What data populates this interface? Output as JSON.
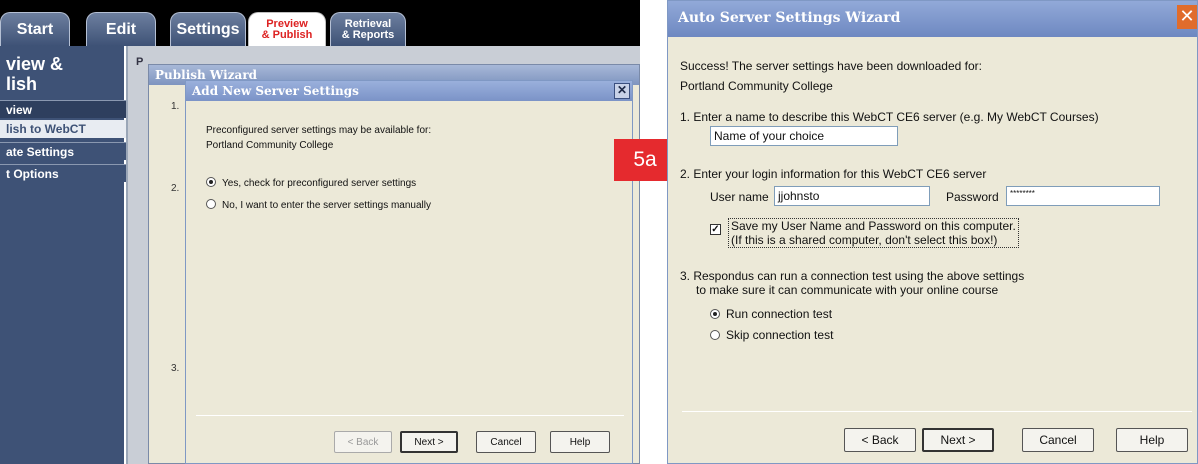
{
  "respondus": {
    "tabs": {
      "start": "Start",
      "edit": "Edit",
      "settings": "Settings",
      "preview_l1": "Preview",
      "preview_l2": "& Publish",
      "retrieval_l1": "Retrieval",
      "retrieval_l2": "& Reports"
    },
    "sidebar": {
      "heading_l1": "view &",
      "heading_l2": "lish",
      "items": [
        {
          "label": "view"
        },
        {
          "label": "lish to WebCT"
        },
        {
          "label": "ate Settings"
        },
        {
          "label": "t Options"
        }
      ]
    },
    "main": {
      "panel_label": "P"
    },
    "publish_wizard": {
      "title": "Publish Wizard",
      "steps": [
        "1.",
        "2.",
        "3."
      ]
    },
    "add_new_server": {
      "title": "Add New Server Settings",
      "close": "✕",
      "message_l1": "Preconfigured server settings may be available for:",
      "message_l2": "Portland Community College",
      "option_yes": "Yes, check for preconfigured server settings",
      "option_no": "No, I want to enter the server settings manually",
      "buttons": {
        "back": "< Back",
        "next": "Next >",
        "cancel": "Cancel",
        "help": "Help"
      }
    }
  },
  "step_badge": "5a",
  "auto_wizard": {
    "title": "Auto Server Settings Wizard",
    "close": "✕",
    "success_l1": "Success! The server settings have been downloaded for:",
    "success_l2": "Portland Community College",
    "step1": "1.  Enter a name to describe this WebCT CE6 server (e.g. My WebCT Courses)",
    "name_value": "Name of your choice",
    "step2": "2.  Enter your login information for this WebCT CE6 server",
    "username_label": "User name",
    "username_value": "jjohnsto",
    "password_label": "Password",
    "password_value": "********",
    "save_l1": "Save my User Name and Password on this computer.",
    "save_l2": "(If this is a shared computer, don't select this box!)",
    "save_checked": "✓",
    "step3_l1": "3.  Respondus can run a connection test using the above settings",
    "step3_l2": "to make sure it can communicate with your online course",
    "run_test": "Run connection test",
    "skip_test": "Skip connection test",
    "buttons": {
      "back": "< Back",
      "next": "Next >",
      "cancel": "Cancel",
      "help": "Help"
    }
  }
}
